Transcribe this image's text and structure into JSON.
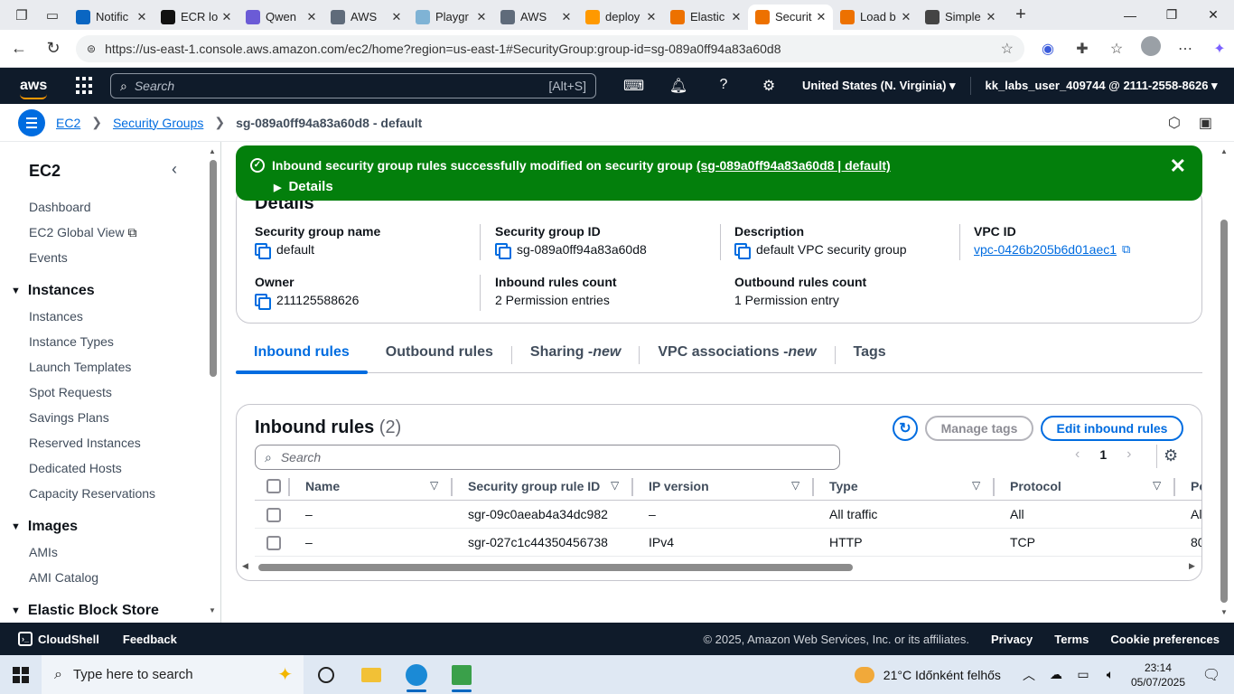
{
  "browser": {
    "tabs": [
      {
        "label": "Notific",
        "color": "#0a66c2"
      },
      {
        "label": "ECR lo",
        "color": "#111111"
      },
      {
        "label": "Qwen",
        "color": "#6b5bd6"
      },
      {
        "label": "AWS",
        "color": "#5f6b7a"
      },
      {
        "label": "Playgr",
        "color": "#7fb3d5"
      },
      {
        "label": "AWS",
        "color": "#5f6b7a"
      },
      {
        "label": "deploy",
        "color": "#ff9900"
      },
      {
        "label": "Elastic",
        "color": "#ed7100"
      },
      {
        "label": "Securit",
        "color": "#ed7100"
      },
      {
        "label": "Load b",
        "color": "#ed7100"
      },
      {
        "label": "Simple",
        "color": "#444444"
      }
    ],
    "active_tab_index": 8,
    "url": "https://us-east-1.console.aws.amazon.com/ec2/home?region=us-east-1#SecurityGroup:group-id=sg-089a0ff94a83a60d8"
  },
  "aws_nav": {
    "logo": "aws",
    "search_placeholder": "Search",
    "search_shortcut": "[Alt+S]",
    "region": "United States (N. Virginia) ▾",
    "account": "kk_labs_user_409744 @ 2111-2558-8626 ▾"
  },
  "breadcrumb": {
    "root": "EC2",
    "section": "Security Groups",
    "current": "sg-089a0ff94a83a60d8 - default"
  },
  "sidebar": {
    "title": "EC2",
    "top_items": [
      "Dashboard",
      "EC2 Global View",
      "Events"
    ],
    "instances_header": "Instances",
    "instances_items": [
      "Instances",
      "Instance Types",
      "Launch Templates",
      "Spot Requests",
      "Savings Plans",
      "Reserved Instances",
      "Dedicated Hosts",
      "Capacity Reservations"
    ],
    "images_header": "Images",
    "images_items": [
      "AMIs",
      "AMI Catalog"
    ],
    "ebs_header": "Elastic Block Store"
  },
  "flash": {
    "message": "Inbound security group rules successfully modified on security group ",
    "link": "(sg-089a0ff94a83a60d8 | default)",
    "details": "Details"
  },
  "details": {
    "heading": "Details",
    "sg_name_label": "Security group name",
    "sg_name": "default",
    "sg_id_label": "Security group ID",
    "sg_id": "sg-089a0ff94a83a60d8",
    "description_label": "Description",
    "description": "default VPC security group",
    "vpc_id_label": "VPC ID",
    "vpc_id": "vpc-0426b205b6d01aec1",
    "owner_label": "Owner",
    "owner": "211125588626",
    "inbound_count_label": "Inbound rules count",
    "inbound_count": "2 Permission entries",
    "outbound_count_label": "Outbound rules count",
    "outbound_count": "1 Permission entry"
  },
  "tabs": {
    "inbound": "Inbound rules",
    "outbound": "Outbound rules",
    "sharing": "Sharing - ",
    "sharing_new": "new",
    "vpc_assoc": "VPC associations - ",
    "vpc_assoc_new": "new",
    "tags": "Tags"
  },
  "rules": {
    "title": "Inbound rules",
    "count": "(2)",
    "manage_tags": "Manage tags",
    "edit": "Edit inbound rules",
    "search_placeholder": "Search",
    "page": "1",
    "columns": [
      "Name",
      "Security group rule ID",
      "IP version",
      "Type",
      "Protocol",
      "Po"
    ],
    "rows": [
      [
        "–",
        "sgr-09c0aeab4a34dc982",
        "–",
        "All traffic",
        "All",
        "Al"
      ],
      [
        "–",
        "sgr-027c1c44350456738",
        "IPv4",
        "HTTP",
        "TCP",
        "80"
      ]
    ]
  },
  "footer": {
    "cloudshell": "CloudShell",
    "feedback": "Feedback",
    "copyright": "© 2025, Amazon Web Services, Inc. or its affiliates.",
    "privacy": "Privacy",
    "terms": "Terms",
    "cookies": "Cookie preferences"
  },
  "taskbar": {
    "search_placeholder": "Type here to search",
    "weather": "21°C  Időnként felhős",
    "time": "23:14",
    "date": "05/07/2025"
  }
}
